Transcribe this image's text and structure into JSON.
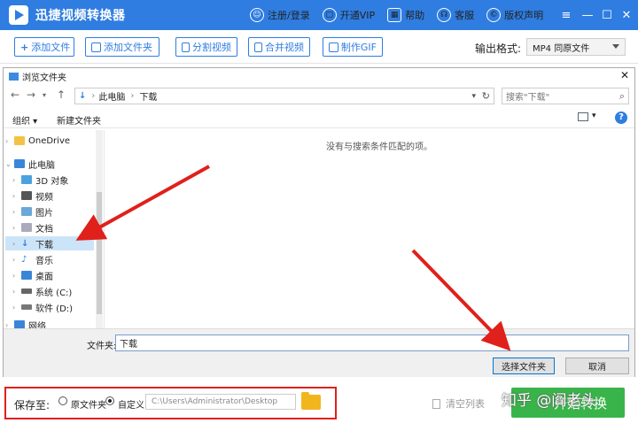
{
  "header": {
    "app_title": "迅捷视频转换器",
    "links": [
      {
        "icon": "user-icon",
        "glyph": "☺",
        "label": "注册/登录"
      },
      {
        "icon": "cart-icon",
        "glyph": "▢",
        "label": "开通VIP"
      },
      {
        "icon": "grid-icon",
        "glyph": "▦",
        "label": "帮助"
      },
      {
        "icon": "headset-icon",
        "glyph": "☊",
        "label": "客服"
      },
      {
        "icon": "copyright-icon",
        "glyph": "©",
        "label": "版权声明"
      }
    ],
    "controls": {
      "menu": "≡",
      "minimize": "—",
      "maximize": "☐",
      "close": "✕"
    }
  },
  "toolbar": {
    "add_file": "添加文件",
    "add_folder": "添加文件夹",
    "split_video": "分割视频",
    "merge_video": "合并视频",
    "make_gif": "制作GIF",
    "format_label": "输出格式:",
    "format_value": "MP4  同原文件"
  },
  "dialog": {
    "title": "浏览文件夹",
    "breadcrumb": [
      "此电脑",
      "下载"
    ],
    "search_placeholder": "搜索\"下载\"",
    "organize": "组织 ▾",
    "new_folder": "新建文件夹",
    "tree": [
      {
        "label": "OneDrive",
        "icon": "onedrive-icon",
        "color": "#f3c244"
      },
      {
        "label": "此电脑",
        "icon": "computer-icon",
        "color": "#3a86d6"
      },
      {
        "label": "3D 对象",
        "icon": "cube-icon",
        "color": "#4aa3df"
      },
      {
        "label": "视频",
        "icon": "video-icon",
        "color": "#555"
      },
      {
        "label": "图片",
        "icon": "picture-icon",
        "color": "#6aa8d8"
      },
      {
        "label": "文档",
        "icon": "document-icon",
        "color": "#aab"
      },
      {
        "label": "下载",
        "icon": "download-icon",
        "color": "#2f7de1"
      },
      {
        "label": "音乐",
        "icon": "music-icon",
        "color": "#2f7de1"
      },
      {
        "label": "桌面",
        "icon": "desktop-icon",
        "color": "#3a86d6"
      },
      {
        "label": "系统 (C:)",
        "icon": "drive-c-icon",
        "color": "#666"
      },
      {
        "label": "软件 (D:)",
        "icon": "drive-d-icon",
        "color": "#777"
      },
      {
        "label": "网络",
        "icon": "network-icon",
        "color": "#3a86d6"
      }
    ],
    "empty_message": "没有与搜索条件匹配的项。",
    "folder_label": "文件夹:",
    "folder_value": "下载",
    "select_button": "选择文件夹",
    "cancel_button": "取消"
  },
  "save": {
    "label": "保存至:",
    "option_original": "原文件夹",
    "option_custom": "自定义",
    "selected": "自定义",
    "path": "C:\\Users\\Administrator\\Desktop",
    "clear_list": "清空列表",
    "start": "开始转换"
  },
  "watermark": "知乎 @阎老头",
  "annotation_color": "#e0201b"
}
